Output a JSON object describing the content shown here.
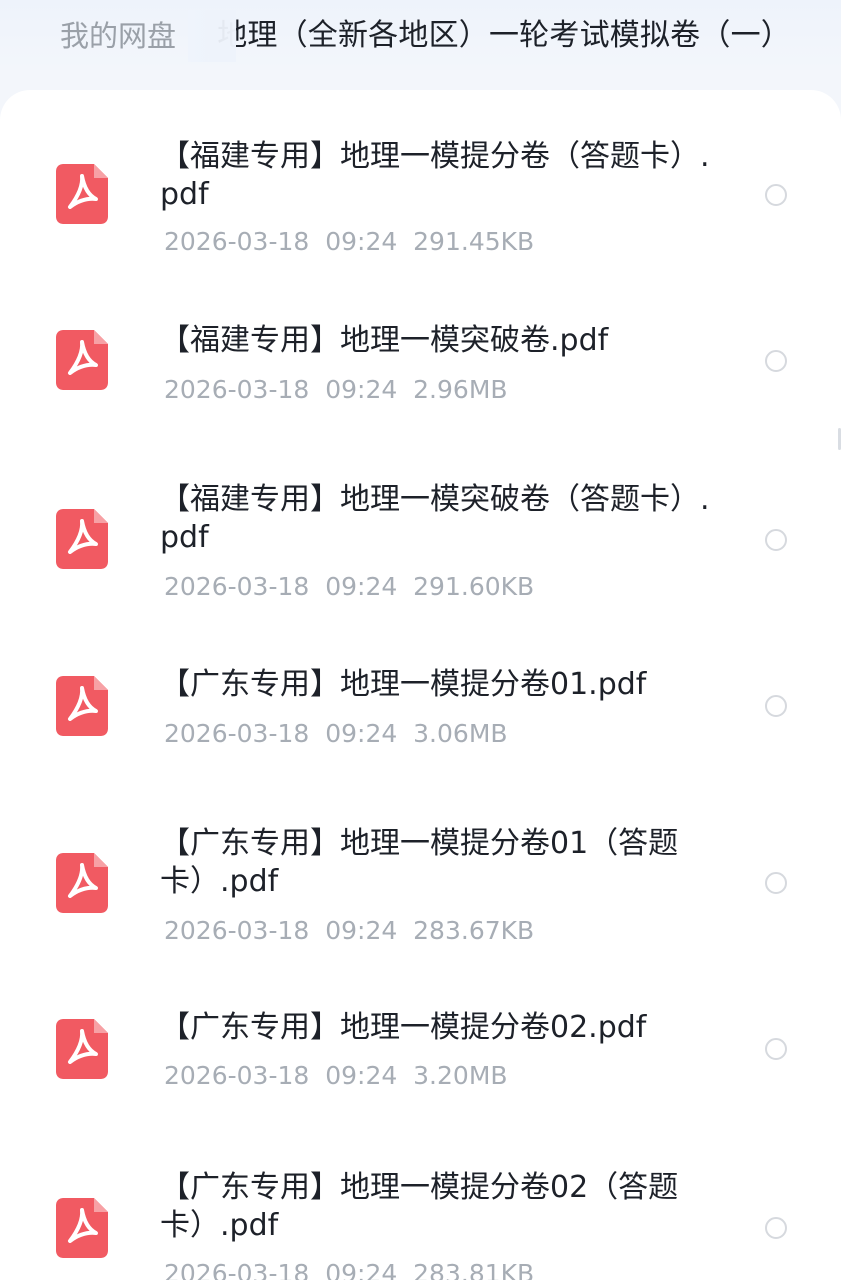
{
  "breadcrumb": {
    "root": "我的网盘",
    "current": "地理（全新各地区）一轮考试模拟卷（一）"
  },
  "icons": {
    "file_type": "pdf-icon",
    "pdf_color": "#f15a62",
    "selector": "radio-circle-icon"
  },
  "files": [
    {
      "name": "【福建专用】地理一模提分卷（答题卡）.pdf",
      "date": "2026-03-18",
      "time": "09:24",
      "size": "291.45KB"
    },
    {
      "name": "【福建专用】地理一模突破卷.pdf",
      "date": "2026-03-18",
      "time": "09:24",
      "size": "2.96MB"
    },
    {
      "name": "【福建专用】地理一模突破卷（答题卡）.pdf",
      "date": "2026-03-18",
      "time": "09:24",
      "size": "291.60KB"
    },
    {
      "name": "【广东专用】地理一模提分卷01.pdf",
      "date": "2026-03-18",
      "time": "09:24",
      "size": "3.06MB"
    },
    {
      "name": "【广东专用】地理一模提分卷01（答题卡）.pdf",
      "date": "2026-03-18",
      "time": "09:24",
      "size": "283.67KB"
    },
    {
      "name": "【广东专用】地理一模提分卷02.pdf",
      "date": "2026-03-18",
      "time": "09:24",
      "size": "3.20MB"
    },
    {
      "name": "【广东专用】地理一模提分卷02（答题卡）.pdf",
      "date": "2026-03-18",
      "time": "09:24",
      "size": "283.81KB"
    }
  ]
}
